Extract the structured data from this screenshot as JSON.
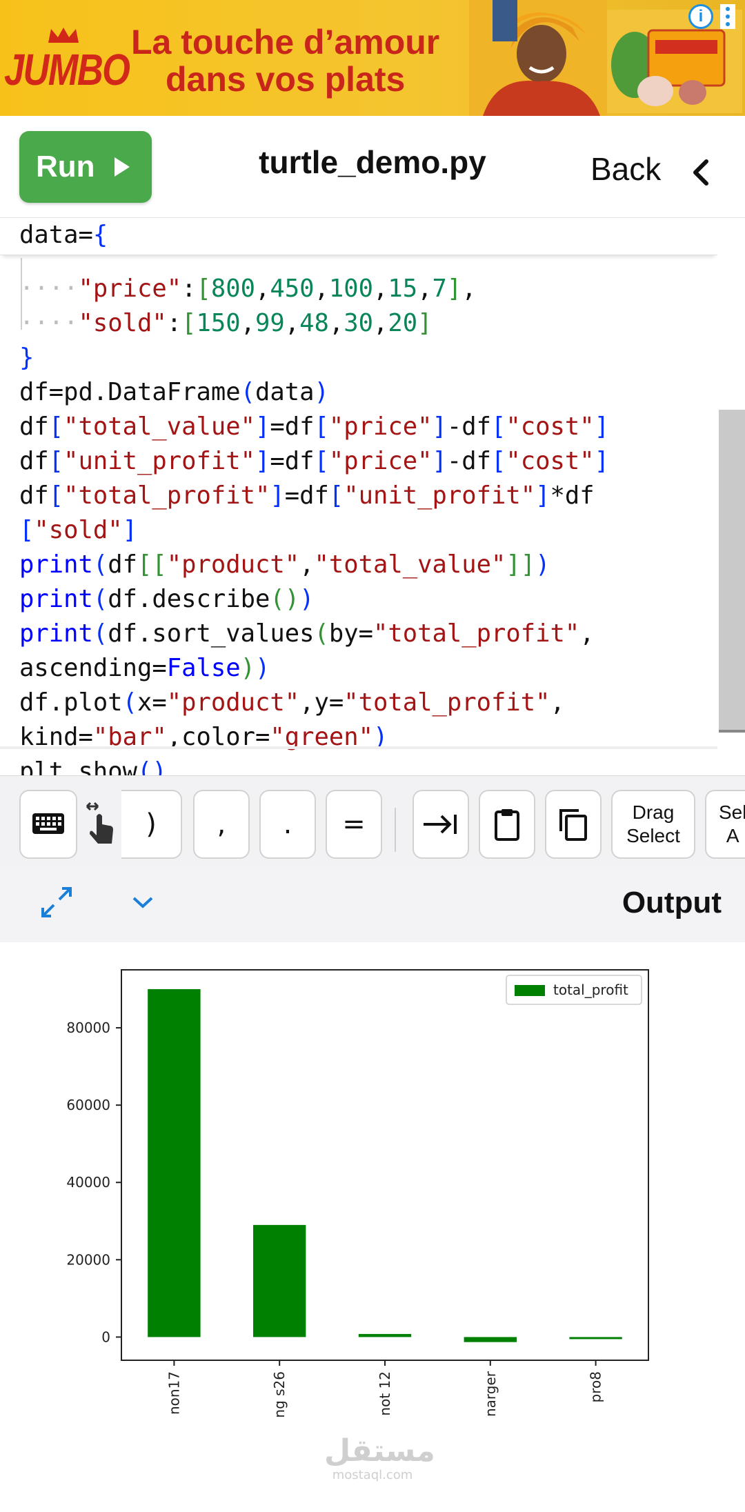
{
  "ad": {
    "brand": "JUMBO",
    "tagline_line1": "La touche d’amour",
    "tagline_line2": "dans vos plats",
    "info_icon": "info-icon",
    "more_icon": "more-vert-icon"
  },
  "toolbar": {
    "run_label": "Run",
    "file_name": "turtle_demo.py",
    "back_label": "Back"
  },
  "code": {
    "lines": [
      "data={",
      "    \"price\":[800,450,100,15,7],",
      "    \"sold\":[150,99,48,30,20]",
      "}",
      "df=pd.DataFrame(data)",
      "df[\"total_value\"]=df[\"price\"]-df[\"cost\"]",
      "df[\"unit_profit\"]=df[\"price\"]-df[\"cost\"]",
      "df[\"total_profit\"]=df[\"unit_profit\"]*df",
      "[\"sold\"]",
      "print(df[[\"product\",\"total_value\"]])",
      "print(df.describe())",
      "print(df.sort_values(by=\"total_profit\",",
      "ascending=False))",
      "df.plot(x=\"product\",y=\"total_profit\",",
      "kind=\"bar\",color=\"green\")",
      "plt.show()"
    ]
  },
  "symbols": {
    "keys": [
      ")",
      ",",
      ".",
      "="
    ],
    "drag_select": "Drag\nSelect",
    "select_all_partial": "Sel\nA"
  },
  "output": {
    "title": "Output"
  },
  "chart_data": {
    "type": "bar",
    "categories": [
      "non17",
      "ng s26",
      "not 12",
      "narger",
      "pro8"
    ],
    "series": [
      {
        "name": "total_profit",
        "values": [
          90000,
          29000,
          800,
          -1300,
          -200
        ],
        "color": "#008000"
      }
    ],
    "yticks": [
      0,
      20000,
      40000,
      60000,
      80000
    ],
    "ylim": [
      -6000,
      95000
    ],
    "legend": "top-right",
    "grid": false
  },
  "watermark": {
    "arabic": "مستقل",
    "latin": "mostaql.com"
  }
}
